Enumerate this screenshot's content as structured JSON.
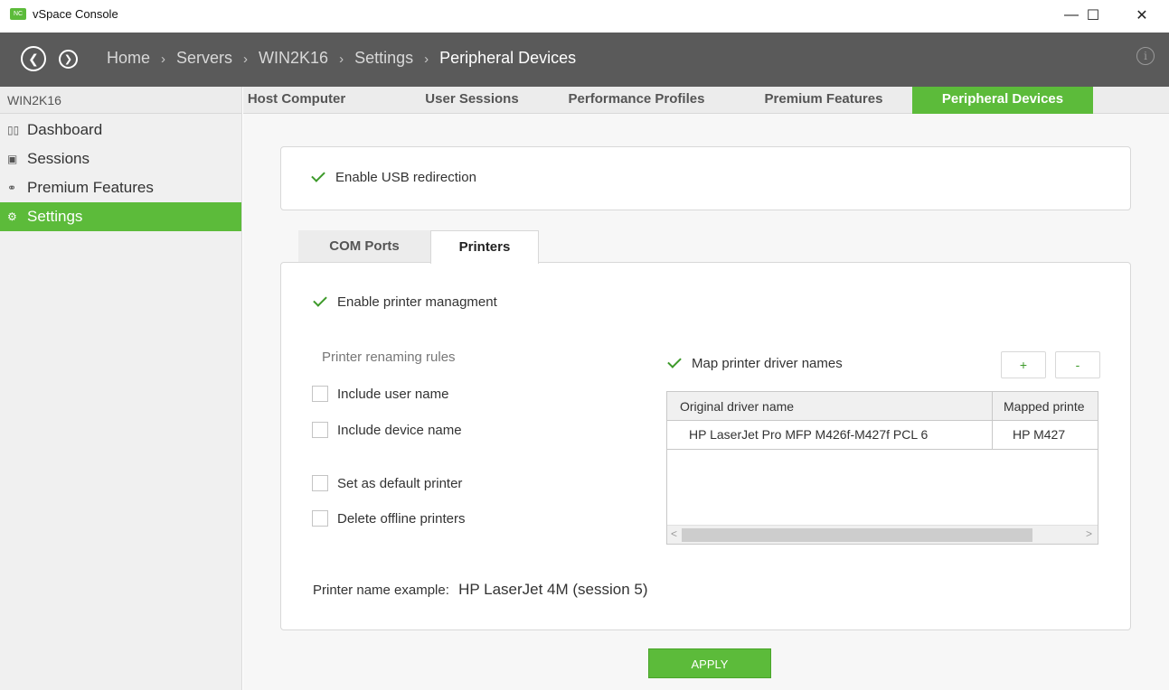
{
  "window": {
    "title": "vSpace Console",
    "logo_text": "NC",
    "minimize_glyph": "—",
    "maximize_glyph": "☐",
    "close_glyph": "✕"
  },
  "breadcrumb": {
    "items": [
      "Home",
      "Servers",
      "WIN2K16",
      "Settings",
      "Peripheral Devices"
    ],
    "separator": "›"
  },
  "sidebar": {
    "header": "WIN2K16",
    "items": [
      {
        "label": "Dashboard",
        "icon": "dashboard-icon",
        "glyph": "▯▯"
      },
      {
        "label": "Sessions",
        "icon": "sessions-icon",
        "glyph": "▣"
      },
      {
        "label": "Premium Features",
        "icon": "premium-features-icon",
        "glyph": "⚭"
      },
      {
        "label": "Settings",
        "icon": "settings-icon",
        "glyph": "⚙",
        "active": true
      }
    ]
  },
  "top_tabs": [
    {
      "label": "Host Computer"
    },
    {
      "label": "User Sessions"
    },
    {
      "label": "Performance Profiles"
    },
    {
      "label": "Premium Features"
    },
    {
      "label": "Peripheral Devices",
      "active": true
    }
  ],
  "usb": {
    "label": "Enable USB redirection",
    "checked": true
  },
  "sub_tabs": [
    {
      "label": "COM Ports"
    },
    {
      "label": "Printers",
      "active": true
    }
  ],
  "printers": {
    "enable_management": {
      "label": "Enable printer managment",
      "checked": true
    },
    "renaming_rules_title": "Printer renaming rules",
    "options": [
      {
        "label": "Include user name",
        "checked": false
      },
      {
        "label": "Include device name",
        "checked": false
      },
      {
        "label": "Set as default printer",
        "checked": false
      },
      {
        "label": "Delete offline printers",
        "checked": false
      }
    ],
    "map_driver_names": {
      "label": "Map printer driver names",
      "checked": true
    },
    "add_label": "+",
    "remove_label": "-",
    "table": {
      "columns": [
        "Original driver name",
        "Mapped printe"
      ],
      "rows": [
        [
          "HP LaserJet Pro MFP M426f-M427f PCL 6",
          "HP M427"
        ]
      ],
      "scroll_left_glyph": "<",
      "scroll_right_glyph": ">"
    },
    "example_label": "Printer name example:",
    "example_value": "HP LaserJet 4M (session 5)"
  },
  "apply_label": "APPLY",
  "colors": {
    "accent": "#5cbb3a",
    "navbar": "#5a5a5a",
    "sidebar": "#f0f0f0"
  }
}
